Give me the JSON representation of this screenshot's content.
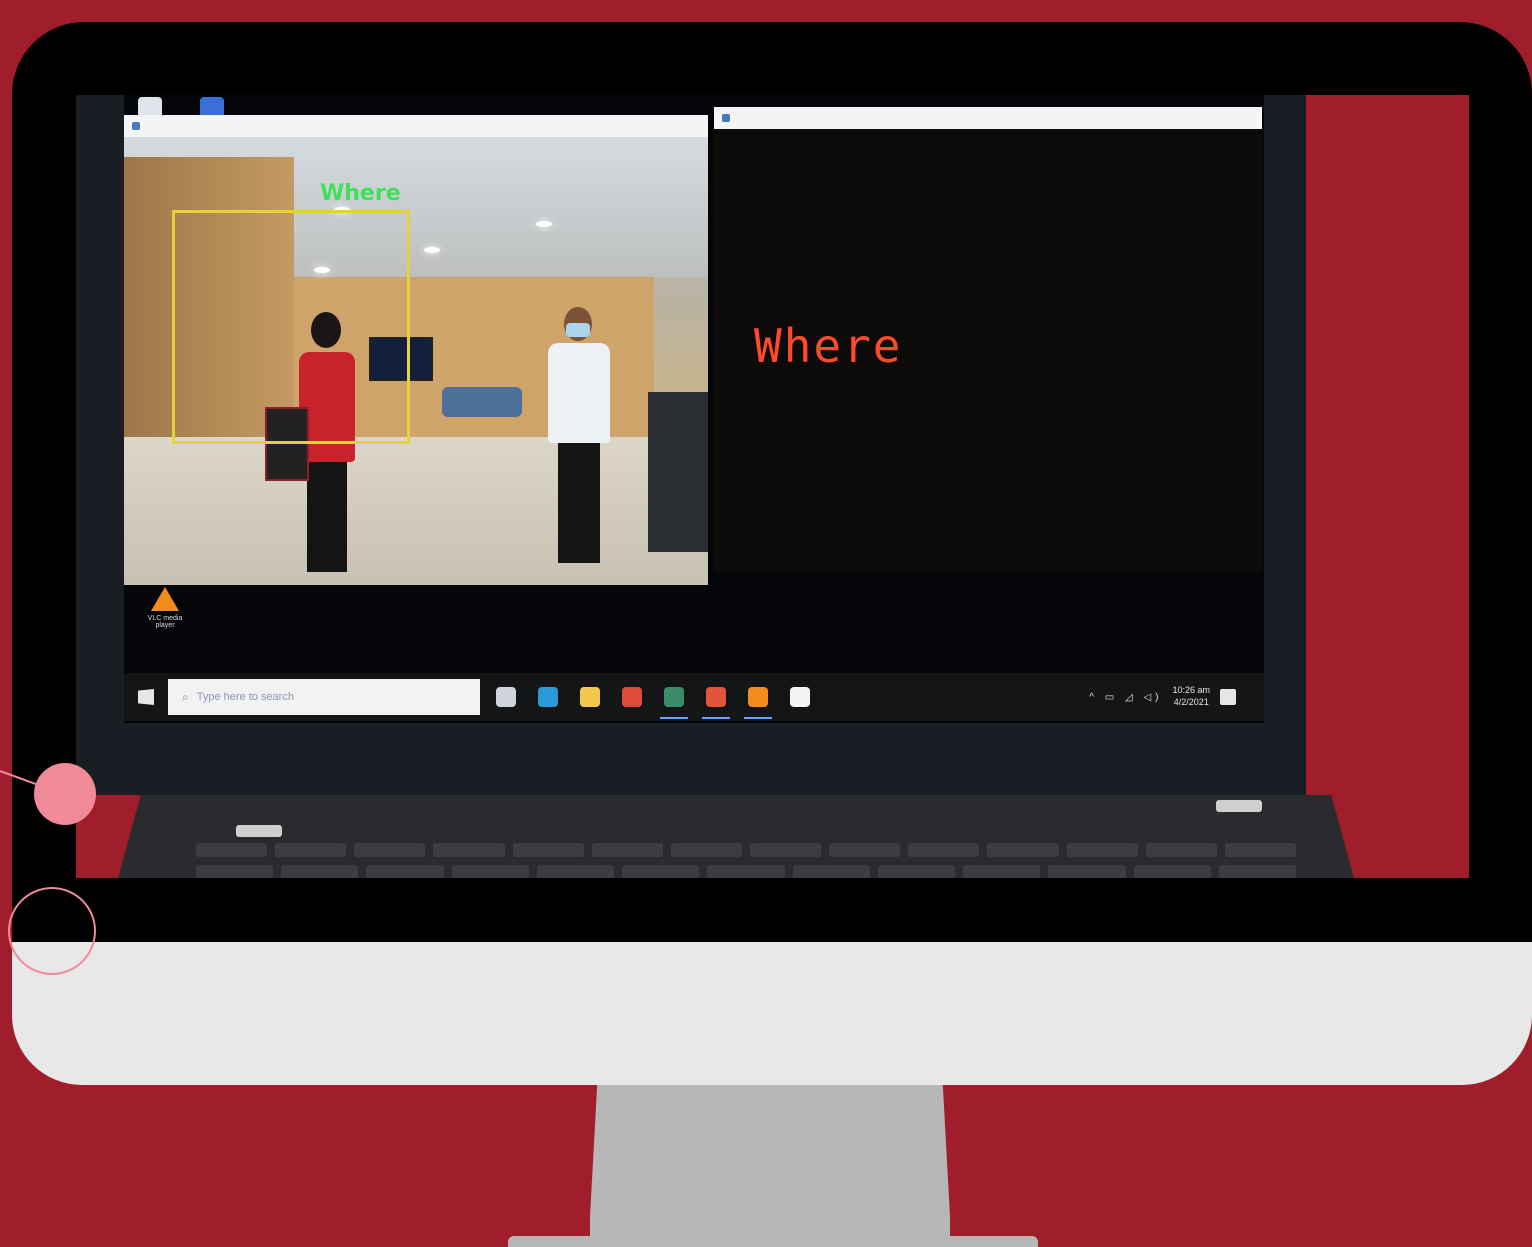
{
  "camera_window": {
    "title": "",
    "detection_label": "Where"
  },
  "output_window": {
    "title": "",
    "recognized_text": "Where"
  },
  "desktop": {
    "vlc_shortcut_label": "VLC media player"
  },
  "taskbar": {
    "search_placeholder": "Type here to search",
    "clock_time": "10:26 am",
    "clock_date": "4/2/2021",
    "apps": [
      {
        "name": "task-view-icon",
        "color": "#cfd3da",
        "active": false
      },
      {
        "name": "edge-icon",
        "color": "#2c9ad8",
        "active": false
      },
      {
        "name": "file-explorer-icon",
        "color": "#f2c94c",
        "active": false
      },
      {
        "name": "chrome-icon",
        "color": "#e14a3b",
        "active": false
      },
      {
        "name": "python-ide-icon",
        "color": "#3b8b6b",
        "active": true
      },
      {
        "name": "media-app-icon",
        "color": "#e2553b",
        "active": true
      },
      {
        "name": "vlc-icon",
        "color": "#f28c1c",
        "active": true
      },
      {
        "name": "notepad-icon",
        "color": "#f4f4f4",
        "active": false
      }
    ]
  },
  "colors": {
    "background": "#a01e2c",
    "bbox": "#e3d23a",
    "detection_text": "#3fe05a",
    "output_text": "#ff4a2a"
  }
}
